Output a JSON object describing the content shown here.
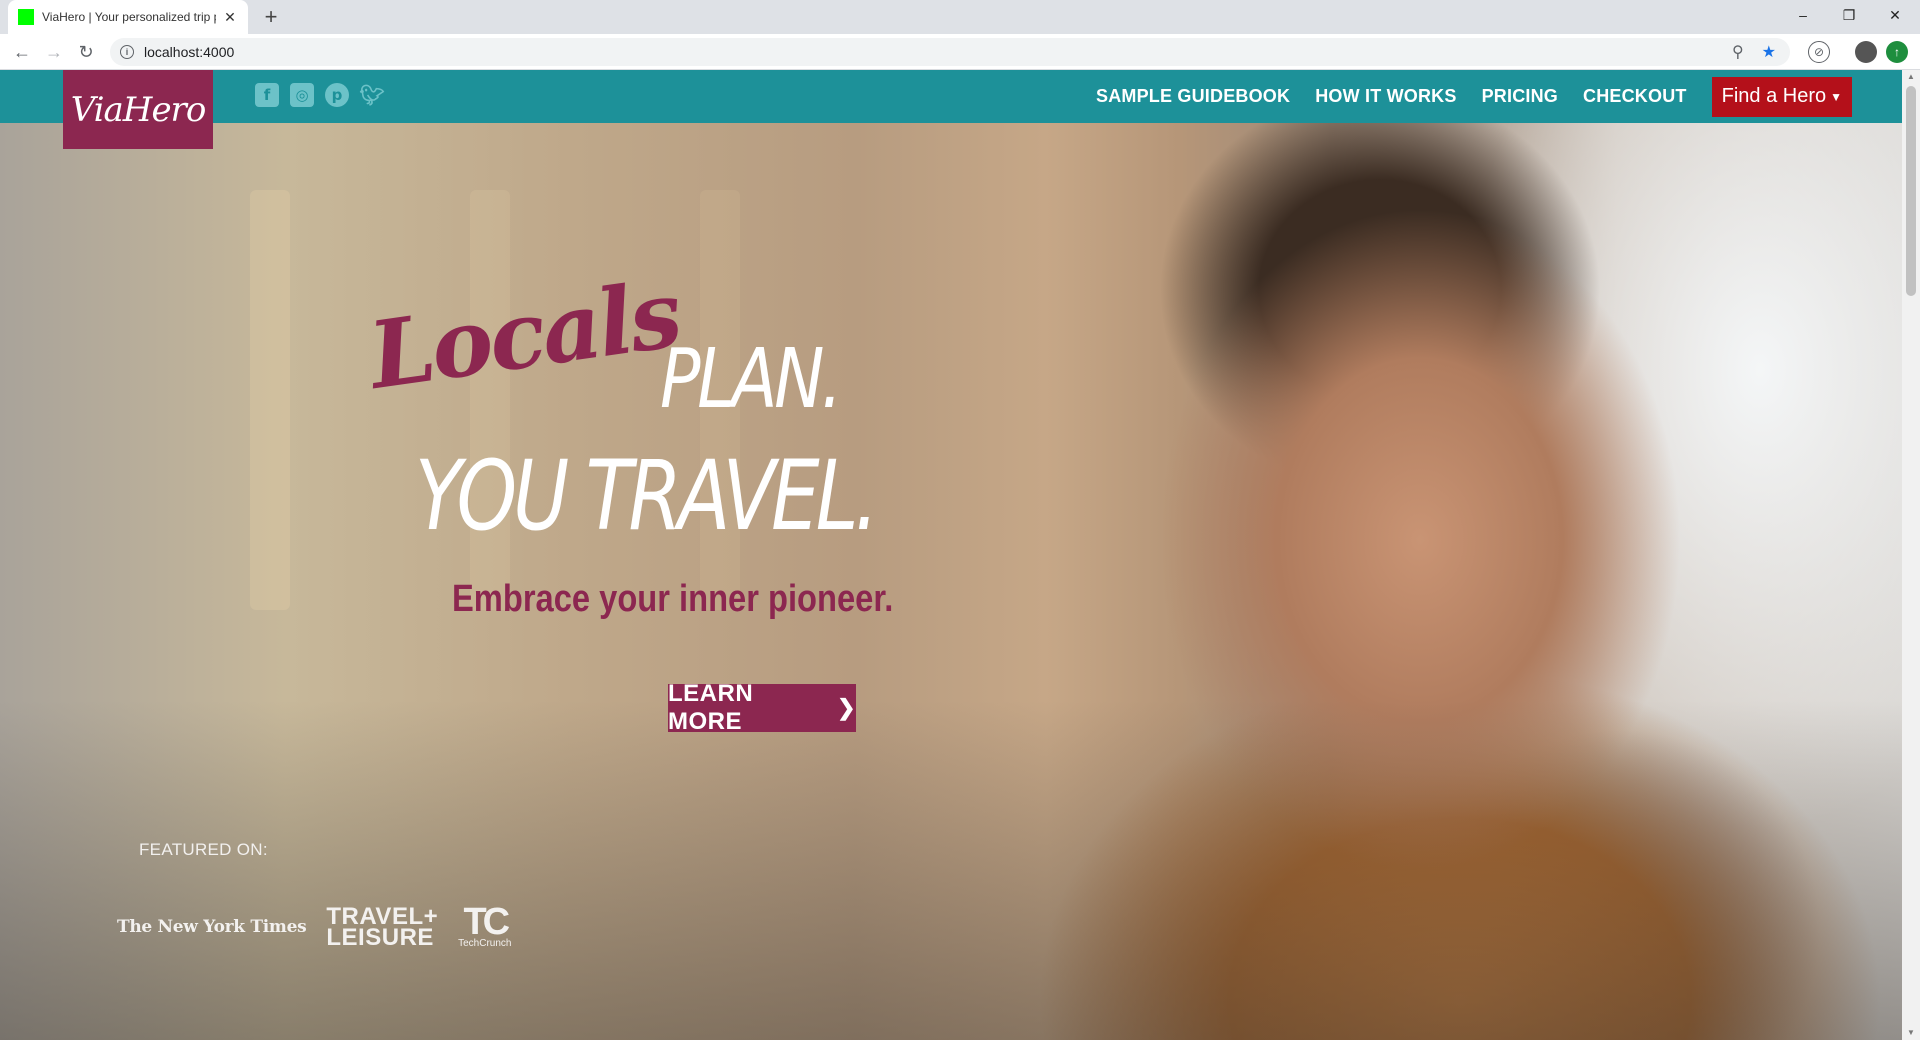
{
  "browser": {
    "tab_title": "ViaHero | Your personalized trip planner",
    "new_tab_label": "+",
    "url": "localhost:4000",
    "window_controls": {
      "minimize": "–",
      "restore": "❐",
      "close": "✕"
    }
  },
  "navbar": {
    "logo_text": "ViaHero",
    "social": [
      "facebook-icon",
      "instagram-icon",
      "pinterest-icon",
      "twitter-icon"
    ],
    "links": [
      "SAMPLE GUIDEBOOK",
      "HOW IT WORKS",
      "PRICING",
      "CHECKOUT"
    ],
    "cta_label": "Find a Hero"
  },
  "hero": {
    "headline_script": "Locals",
    "headline_line1": "PLAN.",
    "headline_line2": "YOU TRAVEL.",
    "tagline": "Embrace your inner pioneer.",
    "cta_label": "LEARN MORE"
  },
  "featured": {
    "label": "FEATURED ON:",
    "outlets": {
      "nyt": "The New York Times",
      "tl_line1": "TRAVEL+",
      "tl_line2": "LEISURE",
      "tc_mark": "TC",
      "tc_name": "TechCrunch"
    }
  },
  "colors": {
    "nav_teal": "#1d9199",
    "brand_maroon": "#8c2750",
    "cta_red": "#b4101a"
  }
}
